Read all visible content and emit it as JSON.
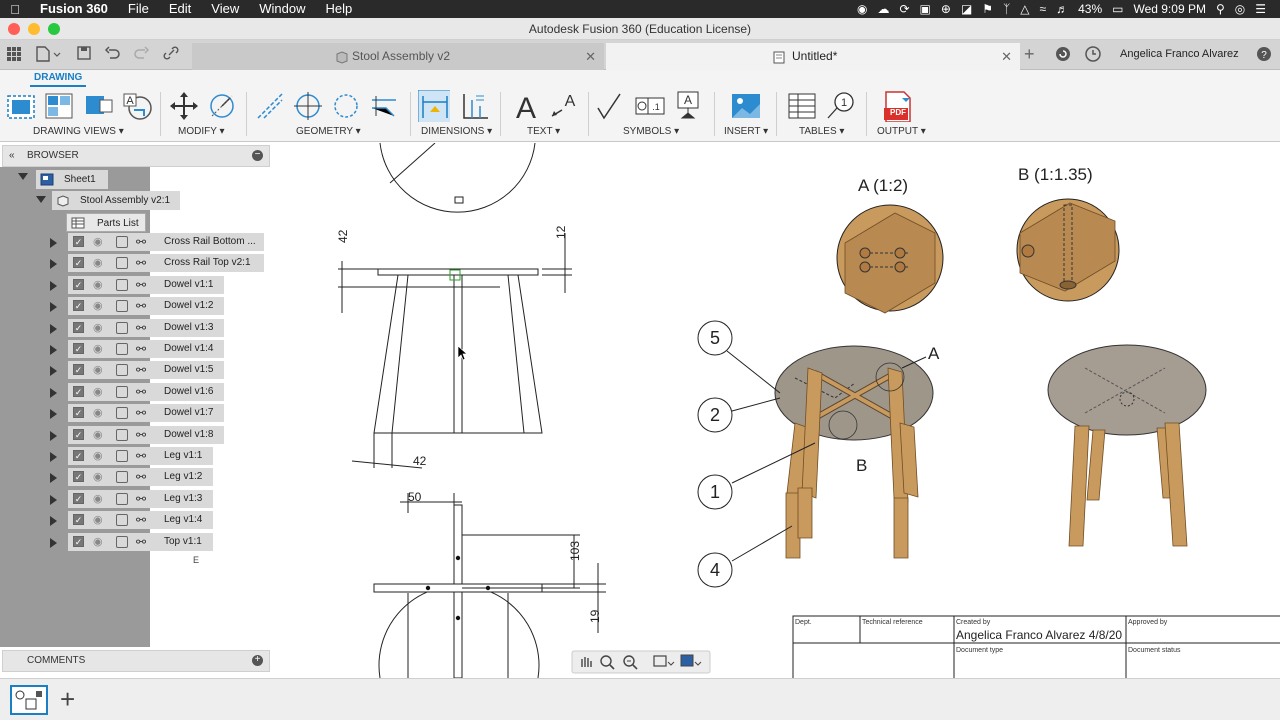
{
  "menubar": {
    "app": "Fusion 360",
    "items": [
      "File",
      "Edit",
      "View",
      "Window",
      "Help"
    ],
    "battery": "43%",
    "clock": "Wed 9:09 PM"
  },
  "window": {
    "title": "Autodesk Fusion 360 (Education License)"
  },
  "tabs": [
    {
      "label": "Stool Assembly v2"
    },
    {
      "label": "Untitled*"
    }
  ],
  "user": {
    "name": "Angelica Franco Alvarez"
  },
  "ribbon": {
    "active_tab": "DRAWING",
    "groups": [
      "DRAWING VIEWS ▾",
      "MODIFY ▾",
      "GEOMETRY ▾",
      "DIMENSIONS ▾",
      "TEXT ▾",
      "SYMBOLS ▾",
      "INSERT ▾",
      "TABLES ▾",
      "OUTPUT ▾"
    ],
    "pdf_label": "PDF"
  },
  "browser": {
    "title": "BROWSER",
    "sheet": "Sheet1",
    "assembly": "Stool Assembly v2:1",
    "parts_list": "Parts List",
    "items": [
      "Cross Rail Bottom ...",
      "Cross Rail Top v2:1",
      "Dowel v1:1",
      "Dowel v1:2",
      "Dowel v1:3",
      "Dowel v1:4",
      "Dowel v1:5",
      "Dowel v1:6",
      "Dowel v1:7",
      "Dowel v1:8",
      "Leg v1:1",
      "Leg v1:2",
      "Leg v1:3",
      "Leg v1:4",
      "Top v1:1"
    ],
    "border_letters": [
      "E"
    ]
  },
  "comments": {
    "title": "COMMENTS"
  },
  "drawing": {
    "dims": {
      "d42_top": "42",
      "d12": "12",
      "d42_bottom": "42",
      "d50": "50",
      "d103": "103",
      "d19": "19"
    },
    "detail_a_label": "A (1:2)",
    "detail_b_label": "B (1:1.35)",
    "balloons": [
      "5",
      "2",
      "1",
      "4"
    ],
    "callout_a": "A",
    "callout_b": "B"
  },
  "titleblock": {
    "dept": "Dept.",
    "tech_ref": "Technical reference",
    "created_by_label": "Created by",
    "created_by": "Angelica Franco Alvarez  4/8/20",
    "approved_by_label": "Approved by",
    "doc_type_label": "Document type",
    "doc_status_label": "Document status"
  },
  "colors": {
    "accent": "#1a7fc3",
    "wood": "#c99a5e",
    "wood_dark": "#8a6334",
    "top_surface": "#9f968a",
    "close_red": "#ff5f57",
    "min_yellow": "#febc2e",
    "max_green": "#28c840"
  }
}
